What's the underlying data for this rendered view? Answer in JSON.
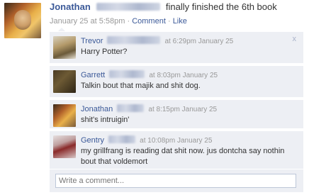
{
  "post": {
    "author": "Jonathan",
    "text": "finally finished the 6th book",
    "timestamp": "January 25 at 5:58pm",
    "separator": "·",
    "comment_link": "Comment",
    "like_link": "Like"
  },
  "comments": [
    {
      "author": "Trevor",
      "time": "at 6:29pm January 25",
      "text": "Harry Potter?",
      "close_label": "x"
    },
    {
      "author": "Garrett",
      "time": "at 8:03pm January 25",
      "text": "Talkin bout that majik and shit dog."
    },
    {
      "author": "Jonathan",
      "time": "at 8:15pm January 25",
      "text": "shit's intruigin'"
    },
    {
      "author": "Gentry",
      "time": "at 10:08pm January 25",
      "text": "my grillfrang is reading dat shit now. jus dontcha say nothin bout that voldemort"
    }
  ],
  "composer": {
    "placeholder": "Write a comment..."
  }
}
